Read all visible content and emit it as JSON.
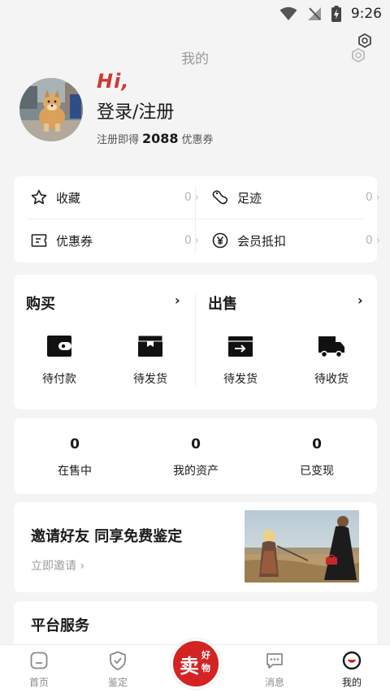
{
  "status_bar": {
    "time": "9:26"
  },
  "header": {
    "title": "我的"
  },
  "profile": {
    "greeting": "Hi,",
    "login_label": "登录/注册",
    "register_prefix": "注册即得",
    "coupon_count": "2088",
    "register_suffix": "优惠券"
  },
  "quick_links": [
    {
      "label": "收藏",
      "count": "0",
      "icon": "star-icon"
    },
    {
      "label": "足迹",
      "count": "0",
      "icon": "footprint-icon"
    },
    {
      "label": "优惠券",
      "count": "0",
      "icon": "coupon-icon"
    },
    {
      "label": "会员抵扣",
      "count": "0",
      "icon": "yen-icon"
    }
  ],
  "buy": {
    "title": "购买",
    "items": [
      {
        "label": "待付款",
        "icon": "wallet-icon"
      },
      {
        "label": "待发货",
        "icon": "box-icon"
      }
    ]
  },
  "sell": {
    "title": "出售",
    "items": [
      {
        "label": "待发货",
        "icon": "ship-box-icon"
      },
      {
        "label": "待收货",
        "icon": "truck-icon"
      }
    ]
  },
  "stats": [
    {
      "value": "0",
      "label": "在售中"
    },
    {
      "value": "0",
      "label": "我的资产"
    },
    {
      "value": "0",
      "label": "已变现"
    }
  ],
  "invite": {
    "title": "邀请好友 同享免费鉴定",
    "link": "立即邀请"
  },
  "services": {
    "title": "平台服务"
  },
  "tabbar": {
    "home": "首页",
    "appraise": "鉴定",
    "sell_main": "卖",
    "sell_sub1": "好",
    "sell_sub2": "物",
    "messages": "消息",
    "mine": "我的"
  },
  "colors": {
    "accent": "#d32323",
    "background": "#f4f4f4",
    "card": "#ffffff"
  }
}
